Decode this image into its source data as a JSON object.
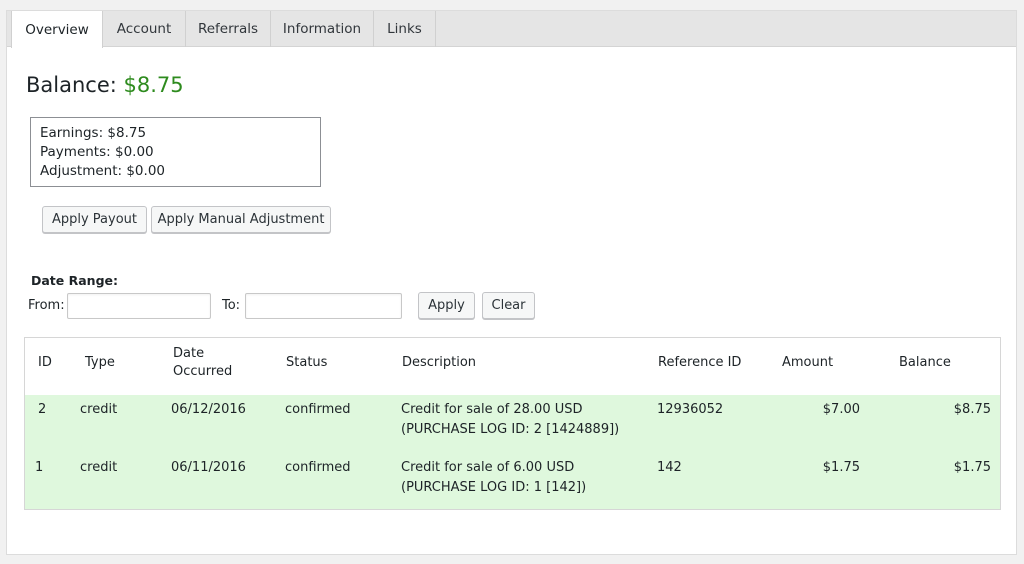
{
  "tabs": [
    "Overview",
    "Account",
    "Referrals",
    "Information",
    "Links"
  ],
  "balance": {
    "label": "Balance:",
    "amount": "$8.75"
  },
  "summary": {
    "earnings": "Earnings: $8.75",
    "payments": "Payments: $0.00",
    "adjustment": "Adjustment: $0.00"
  },
  "actions": {
    "apply_payout": "Apply Payout",
    "apply_manual_adjustment": "Apply Manual Adjustment"
  },
  "date_range": {
    "title": "Date Range:",
    "from_label": "From:",
    "to_label": "To:",
    "from_value": "",
    "to_value": "",
    "apply": "Apply",
    "clear": "Clear"
  },
  "table": {
    "headers": {
      "id": "ID",
      "type": "Type",
      "date_line1": "Date",
      "date_line2": "Occurred",
      "status": "Status",
      "description": "Description",
      "reference": "Reference ID",
      "amount": "Amount",
      "balance": "Balance"
    },
    "rows": [
      {
        "id": "2",
        "type": "credit",
        "date": "06/12/2016",
        "status": "confirmed",
        "desc_line1": "Credit for sale of 28.00 USD",
        "desc_line2": "(PURCHASE LOG ID: 2 [1424889])",
        "reference": "12936052",
        "amount": "$7.00",
        "balance": "$8.75"
      },
      {
        "id": "1",
        "type": "credit",
        "date": "06/11/2016",
        "status": "confirmed",
        "desc_line1": "Credit for sale of 6.00 USD",
        "desc_line2": "(PURCHASE LOG ID: 1 [142])",
        "reference": "142",
        "amount": "$1.75",
        "balance": "$1.75"
      }
    ]
  },
  "colors": {
    "balance_amount": "#2e8b1e",
    "row_highlight": "#dff8dd"
  }
}
